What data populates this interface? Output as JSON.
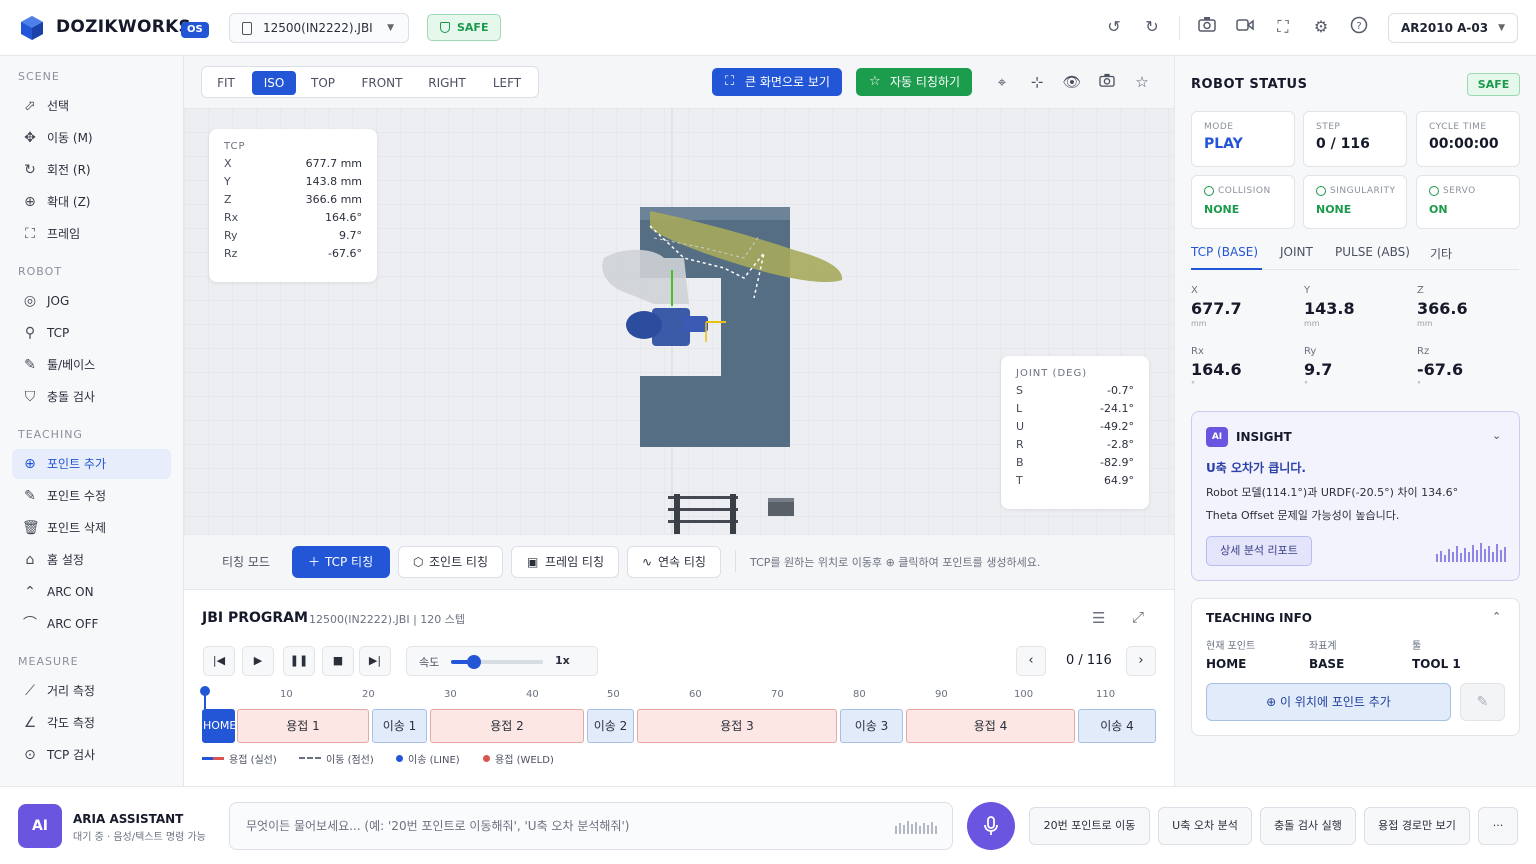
{
  "app": {
    "name": "DOZIKWORKS",
    "badge": "OS"
  },
  "topbar": {
    "file": "12500(IN2222).JBI",
    "safety": "SAFE",
    "robot": "AR2010 A-03",
    "icons": [
      "undo-icon",
      "redo-icon",
      "camera-icon",
      "video-icon",
      "fullscreen-icon",
      "gear-icon",
      "help-icon"
    ]
  },
  "sidebar": {
    "scene_title": "SCENE",
    "scene": [
      {
        "label": "선택",
        "icon": "cursor-icon"
      },
      {
        "label": "이동 (M)",
        "icon": "move-icon"
      },
      {
        "label": "회전 (R)",
        "icon": "rotate-icon"
      },
      {
        "label": "확대 (Z)",
        "icon": "zoom-icon"
      },
      {
        "label": "프레임",
        "icon": "frame-icon"
      }
    ],
    "robot_title": "ROBOT",
    "robot": [
      {
        "label": "JOG",
        "icon": "jog-icon"
      },
      {
        "label": "TCP",
        "icon": "tcp-icon"
      },
      {
        "label": "툴/베이스",
        "icon": "tool-icon"
      },
      {
        "label": "충돌 검사",
        "icon": "shield-icon"
      }
    ],
    "teaching_title": "TEACHING",
    "teaching": [
      {
        "label": "포인트 추가",
        "icon": "add-point-icon",
        "active": true
      },
      {
        "label": "포인트 수정",
        "icon": "edit-icon"
      },
      {
        "label": "포인트 삭제",
        "icon": "trash-icon"
      },
      {
        "label": "홈 설정",
        "icon": "home-icon"
      },
      {
        "label": "ARC ON",
        "icon": "arc-on-icon"
      },
      {
        "label": "ARC OFF",
        "icon": "arc-off-icon"
      }
    ],
    "measure_title": "MEASURE",
    "measure": [
      {
        "label": "거리 측정",
        "icon": "ruler-icon"
      },
      {
        "label": "각도 측정",
        "icon": "angle-icon"
      },
      {
        "label": "TCP 검사",
        "icon": "target-icon"
      }
    ]
  },
  "view": {
    "tabs": [
      "FIT",
      "ISO",
      "TOP",
      "FRONT",
      "RIGHT",
      "LEFT"
    ],
    "active_tab": "ISO",
    "fullscreen_label": "큰 화면으로 보기",
    "auto_teach_label": "자동 티칭하기"
  },
  "tcp": {
    "title": "TCP",
    "rows": [
      {
        "k": "X",
        "v": "677.7 mm"
      },
      {
        "k": "Y",
        "v": "143.8 mm"
      },
      {
        "k": "Z",
        "v": "366.6 mm"
      },
      {
        "k": "Rx",
        "v": "164.6°"
      },
      {
        "k": "Ry",
        "v": "9.7°"
      },
      {
        "k": "Rz",
        "v": "-67.6°"
      }
    ]
  },
  "joint": {
    "title": "JOINT (DEG)",
    "rows": [
      {
        "k": "S",
        "v": "-0.7°"
      },
      {
        "k": "L",
        "v": "-24.1°"
      },
      {
        "k": "U",
        "v": "-49.2°"
      },
      {
        "k": "R",
        "v": "-2.8°"
      },
      {
        "k": "B",
        "v": "-82.9°"
      },
      {
        "k": "T",
        "v": "64.9°"
      }
    ]
  },
  "teach": {
    "label": "티칭 모드",
    "buttons": [
      "TCP 티칭",
      "조인트 티칭",
      "프레임 티칭",
      "연속 티칭"
    ],
    "hint": "TCP를 원하는 위치로 이동후 ⊕ 클릭하여 포인트를 생성하세요."
  },
  "program": {
    "title": "JBI PROGRAM",
    "subtitle": "12500(IN2222).JBI | 120 스텝",
    "speed_label": "속도",
    "speed_value": "1x",
    "speed_fraction": 0.25,
    "step_display": "0 / 116",
    "ticks": [
      "10",
      "20",
      "30",
      "40",
      "50",
      "60",
      "70",
      "80",
      "90",
      "100",
      "110"
    ],
    "segments": [
      {
        "label": "HOME",
        "type": "home"
      },
      {
        "label": "용접 1",
        "type": "weld"
      },
      {
        "label": "이송 1",
        "type": "move"
      },
      {
        "label": "용접 2",
        "type": "weld"
      },
      {
        "label": "이송 2",
        "type": "move"
      },
      {
        "label": "용접 3",
        "type": "weld"
      },
      {
        "label": "이송 3",
        "type": "move"
      },
      {
        "label": "용접 4",
        "type": "weld"
      },
      {
        "label": "이송 4",
        "type": "move"
      }
    ],
    "legend": [
      "용접 (실선)",
      "이동 (점선)",
      "이송 (LINE)",
      "용접 (WELD)"
    ],
    "colors": {
      "weld": "#d9534f",
      "move": "#2356d6"
    }
  },
  "status": {
    "title": "ROBOT STATUS",
    "safety": "SAFE",
    "mode_label": "MODE",
    "mode_value": "PLAY",
    "step_label": "STEP",
    "step_value": "0 / 116",
    "cycle_label": "CYCLE TIME",
    "cycle_value": "00:00:00",
    "collision_label": "COLLISION",
    "collision_value": "NONE",
    "singularity_label": "SINGULARITY",
    "singularity_value": "NONE",
    "servo_label": "SERVO",
    "servo_value": "ON",
    "tabs": [
      "TCP (BASE)",
      "JOINT",
      "PULSE (ABS)",
      "기타"
    ],
    "coords": [
      {
        "label": "X",
        "value": "677.7",
        "unit": "mm"
      },
      {
        "label": "Y",
        "value": "143.8",
        "unit": "mm"
      },
      {
        "label": "Z",
        "value": "366.6",
        "unit": "mm"
      },
      {
        "label": "Rx",
        "value": "164.6",
        "unit": "°"
      },
      {
        "label": "Ry",
        "value": "9.7",
        "unit": "°"
      },
      {
        "label": "Rz",
        "value": "-67.6",
        "unit": "°"
      }
    ]
  },
  "insight": {
    "chip": "AI",
    "title": "INSIGHT",
    "headline": "U축 오차가 큽니다.",
    "line1": "Robot 모델(114.1°)과 URDF(-20.5°) 차이 134.6°",
    "line2": "Theta Offset 문제일 가능성이 높습니다.",
    "button": "상세 분석 리포트"
  },
  "teaching_info": {
    "title": "TEACHING INFO",
    "current_label": "현재 포인트",
    "current_value": "HOME",
    "coord_label": "좌표계",
    "coord_value": "BASE",
    "tool_label": "툴",
    "tool_value": "TOOL 1",
    "add_button": "이 위치에 포인트 추가"
  },
  "assistant": {
    "avatar": "AI",
    "name": "ARIA ASSISTANT",
    "status": "대기 중 · 음성/텍스트 명령 가능",
    "placeholder": "무엇이든 물어보세요... (예: '20번 포인트로 이동해줘', 'U축 오차 분석해줘')",
    "quick": [
      "20번 포인트로 이동",
      "U축 오차 분석",
      "충돌 검사 실행",
      "용접 경로만 보기",
      "···"
    ]
  }
}
